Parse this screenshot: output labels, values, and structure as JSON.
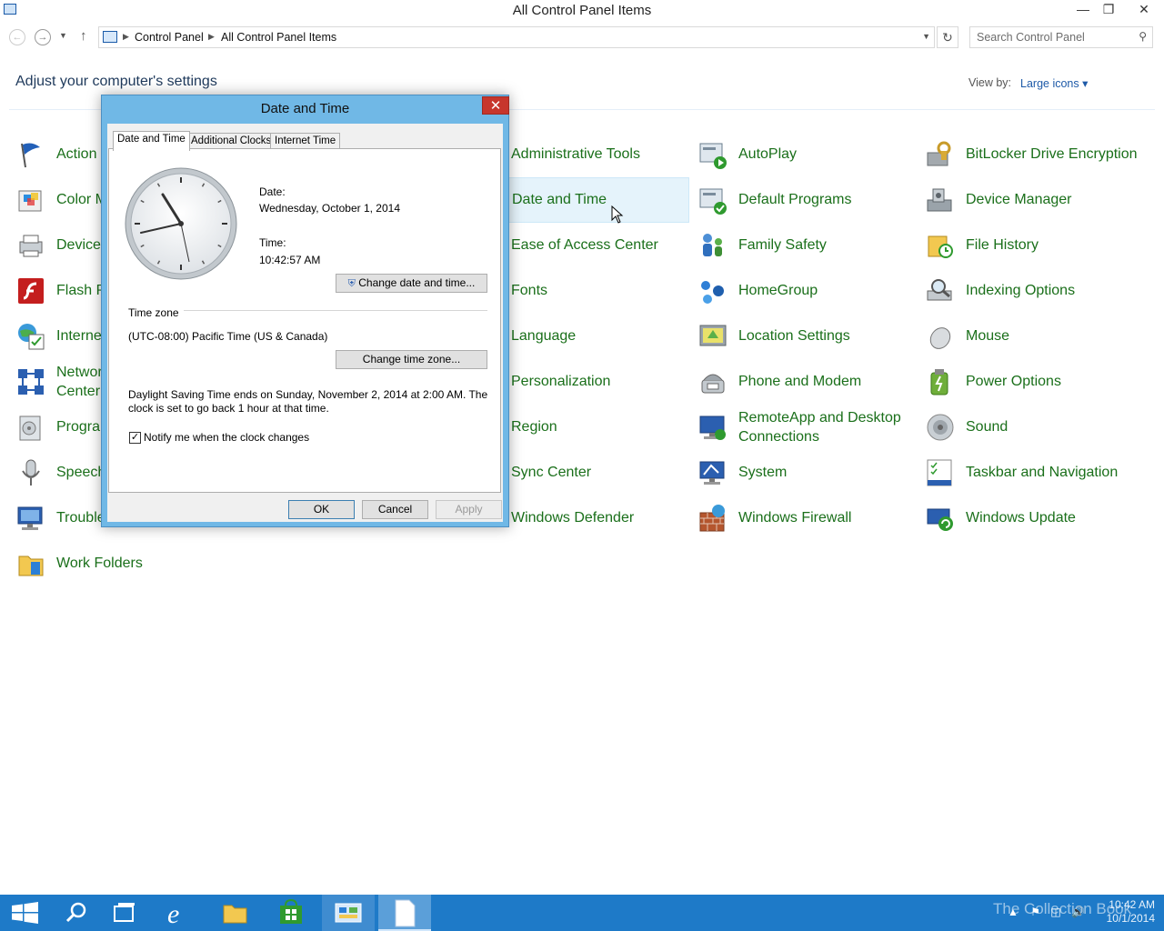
{
  "window": {
    "title": "All Control Panel Items"
  },
  "address": {
    "crumbs": [
      "Control Panel",
      "All Control Panel Items"
    ],
    "search_placeholder": "Search Control Panel"
  },
  "heading": "Adjust your computer's settings",
  "view_by": {
    "label": "View by:",
    "value": "Large icons"
  },
  "items": [
    {
      "label": "Action",
      "icon": "flag-icon"
    },
    {
      "label": "Administrative Tools",
      "icon": "admin-tools-icon"
    },
    {
      "label": "AutoPlay",
      "icon": "autoplay-icon"
    },
    {
      "label": "BitLocker Drive Encryption",
      "icon": "bitlocker-icon"
    },
    {
      "label": "Color M",
      "icon": "color-management-icon"
    },
    {
      "label": "Date and Time",
      "icon": "clock-icon"
    },
    {
      "label": "Default Programs",
      "icon": "default-programs-icon"
    },
    {
      "label": "Device Manager",
      "icon": "device-manager-icon"
    },
    {
      "label": "Devices",
      "icon": "devices-icon"
    },
    {
      "label": "Ease of Access Center",
      "icon": "ease-of-access-icon"
    },
    {
      "label": "Family Safety",
      "icon": "family-safety-icon"
    },
    {
      "label": "File History",
      "icon": "file-history-icon"
    },
    {
      "label": "Flash P",
      "icon": "flash-icon"
    },
    {
      "label": "Fonts",
      "icon": "fonts-icon"
    },
    {
      "label": "HomeGroup",
      "icon": "homegroup-icon"
    },
    {
      "label": "Indexing Options",
      "icon": "indexing-icon"
    },
    {
      "label": "Interne",
      "icon": "internet-options-icon"
    },
    {
      "label": "Language",
      "icon": "language-icon"
    },
    {
      "label": "Location Settings",
      "icon": "location-icon"
    },
    {
      "label": "Mouse",
      "icon": "mouse-icon"
    },
    {
      "label": "Networ Center",
      "icon": "network-icon"
    },
    {
      "label": "Personalization",
      "icon": "personalization-icon"
    },
    {
      "label": "Phone and Modem",
      "icon": "phone-icon"
    },
    {
      "label": "Power Options",
      "icon": "power-icon"
    },
    {
      "label": "Progra",
      "icon": "programs-icon"
    },
    {
      "label": "Region",
      "icon": "region-icon"
    },
    {
      "label": "RemoteApp and Desktop Connections",
      "icon": "remoteapp-icon"
    },
    {
      "label": "Sound",
      "icon": "sound-icon"
    },
    {
      "label": "Speech",
      "icon": "microphone-icon"
    },
    {
      "label": "Sync Center",
      "icon": "sync-icon"
    },
    {
      "label": "System",
      "icon": "system-icon"
    },
    {
      "label": "Taskbar and Navigation",
      "icon": "taskbar-icon"
    },
    {
      "label": "Trouble",
      "icon": "troubleshoot-icon"
    },
    {
      "label": "Windows Defender",
      "icon": "defender-icon"
    },
    {
      "label": "Windows Firewall",
      "icon": "firewall-icon"
    },
    {
      "label": "Windows Update",
      "icon": "update-icon"
    },
    {
      "label": "Work Folders",
      "icon": "work-folders-icon"
    }
  ],
  "dialog": {
    "title": "Date and Time",
    "tabs": [
      "Date and Time",
      "Additional Clocks",
      "Internet Time"
    ],
    "date_label": "Date:",
    "date_value": "Wednesday, October 1, 2014",
    "time_label": "Time:",
    "time_value": "10:42:57 AM",
    "change_datetime_button": "Change date and time...",
    "timezone_group": "Time zone",
    "timezone_value": "(UTC-08:00) Pacific Time (US & Canada)",
    "change_timezone_button": "Change time zone...",
    "dst_note_line1": "Daylight Saving Time ends on Sunday, November 2, 2014 at 2:00 AM. The",
    "dst_note_line2": "clock is set to go back 1 hour at that time.",
    "notify_label": "Notify me when the clock changes",
    "notify_checked": true,
    "ok": "OK",
    "cancel": "Cancel",
    "apply": "Apply"
  },
  "taskbar": {
    "clock_time": "10:42 AM",
    "clock_date": "10/1/2014",
    "watermark": "The Collection Book"
  },
  "colors": {
    "link_green": "#1a6f1a",
    "taskbar_blue": "#1e7ac8",
    "dialog_title_blue": "#70b8e6",
    "close_red": "#c7362c"
  }
}
